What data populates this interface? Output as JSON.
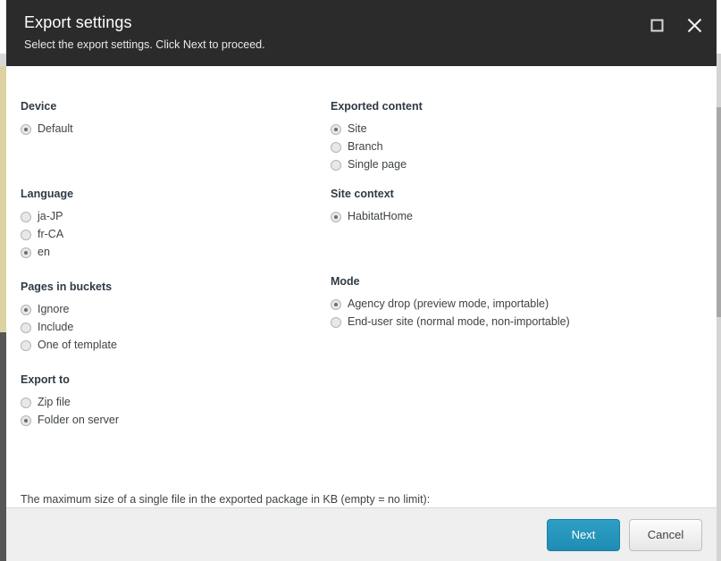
{
  "dialog": {
    "title": "Export settings",
    "subtitle": "Select the export settings. Click Next to proceed.",
    "maximize_icon": "maximize-icon",
    "close_icon": "close-icon"
  },
  "groups": {
    "device": {
      "title": "Device",
      "options": [
        {
          "label": "Default",
          "selected": true
        }
      ]
    },
    "exported_content": {
      "title": "Exported content",
      "options": [
        {
          "label": "Site",
          "selected": true
        },
        {
          "label": "Branch",
          "selected": false
        },
        {
          "label": "Single page",
          "selected": false
        }
      ]
    },
    "language": {
      "title": "Language",
      "options": [
        {
          "label": "ja-JP",
          "selected": false
        },
        {
          "label": "fr-CA",
          "selected": false
        },
        {
          "label": "en",
          "selected": true
        }
      ]
    },
    "site_context": {
      "title": "Site context",
      "options": [
        {
          "label": "HabitatHome",
          "selected": true
        }
      ]
    },
    "pages_in_buckets": {
      "title": "Pages in buckets",
      "options": [
        {
          "label": "Ignore",
          "selected": true
        },
        {
          "label": "Include",
          "selected": false
        },
        {
          "label": "One of template",
          "selected": false
        }
      ]
    },
    "mode": {
      "title": "Mode",
      "options": [
        {
          "label": "Agency drop (preview mode, importable)",
          "selected": true
        },
        {
          "label": "End-user site (normal mode, non-importable)",
          "selected": false
        }
      ]
    },
    "export_to": {
      "title": "Export to",
      "options": [
        {
          "label": "Zip file",
          "selected": false
        },
        {
          "label": "Folder on server",
          "selected": true
        }
      ]
    }
  },
  "max_size_field": {
    "label": "The maximum size of a single file in the exported package in KB (empty = no limit):",
    "value": "",
    "placeholder": ""
  },
  "footer": {
    "next_label": "Next",
    "cancel_label": "Cancel"
  },
  "colors": {
    "header_bg": "#2b2b2b",
    "primary_button": "#1f8cb4",
    "footer_bg": "#efefef",
    "heading_text": "#303a45",
    "body_text": "#3e4347"
  }
}
